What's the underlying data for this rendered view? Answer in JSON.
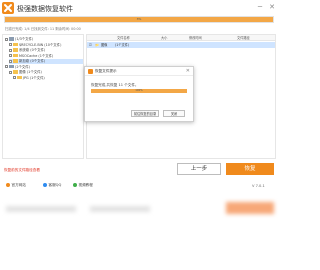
{
  "app": {
    "title": "极强数据恢复软件",
    "min_glyph": "─",
    "close_glyph": "✕"
  },
  "scan": {
    "progress_pct": 100,
    "progress_text": "3%",
    "info": "扫描已完成: 1/4 已找到文件: 11 剩余时间: 00:00"
  },
  "tree": {
    "items": [
      {
        "label": "(1/3个文件)",
        "type": "drive",
        "indent": 0,
        "selected": false
      },
      {
        "label": "$RECYCLE.BIN (10个文件)",
        "type": "folder",
        "indent": 1,
        "selected": false
      },
      {
        "label": "系统卷 (0个文件)",
        "type": "folder",
        "indent": 1,
        "selected": false
      },
      {
        "label": "MSOCache (1个文件)",
        "type": "folder",
        "indent": 1,
        "selected": false
      },
      {
        "label": "新加卷 (0个文件)",
        "type": "folder",
        "indent": 1,
        "selected": true
      },
      {
        "label": "(2个文件)",
        "type": "drive",
        "indent": 0,
        "selected": false
      },
      {
        "label": "图像 (1个文件)",
        "type": "folder",
        "indent": 1,
        "selected": false
      },
      {
        "label": "JPG (1个文件)",
        "type": "folder",
        "indent": 2,
        "selected": false
      }
    ]
  },
  "list": {
    "headers": [
      "文件名称",
      "大小",
      "修改时间",
      "文件路径"
    ],
    "row": {
      "name": "图像",
      "size": "(1个文件)"
    }
  },
  "dialog": {
    "title": "恢复文件提示",
    "close_glyph": "✕",
    "message": "恢复完成,共恢复 11 个文件。",
    "progress_text": "100%",
    "open_button": "前往恢复的目录",
    "close_button": "关闭"
  },
  "footer": {
    "link": "恢复前的文件路径查看",
    "prev_button": "上一步",
    "recover_button": "恢复",
    "version": "V 7.0.1",
    "links": [
      {
        "label": "官方网站",
        "color": "#f08a1c"
      },
      {
        "label": "客服QQ",
        "color": "#2f8cf0"
      },
      {
        "label": "视频教程",
        "color": "#3fae49"
      }
    ]
  }
}
